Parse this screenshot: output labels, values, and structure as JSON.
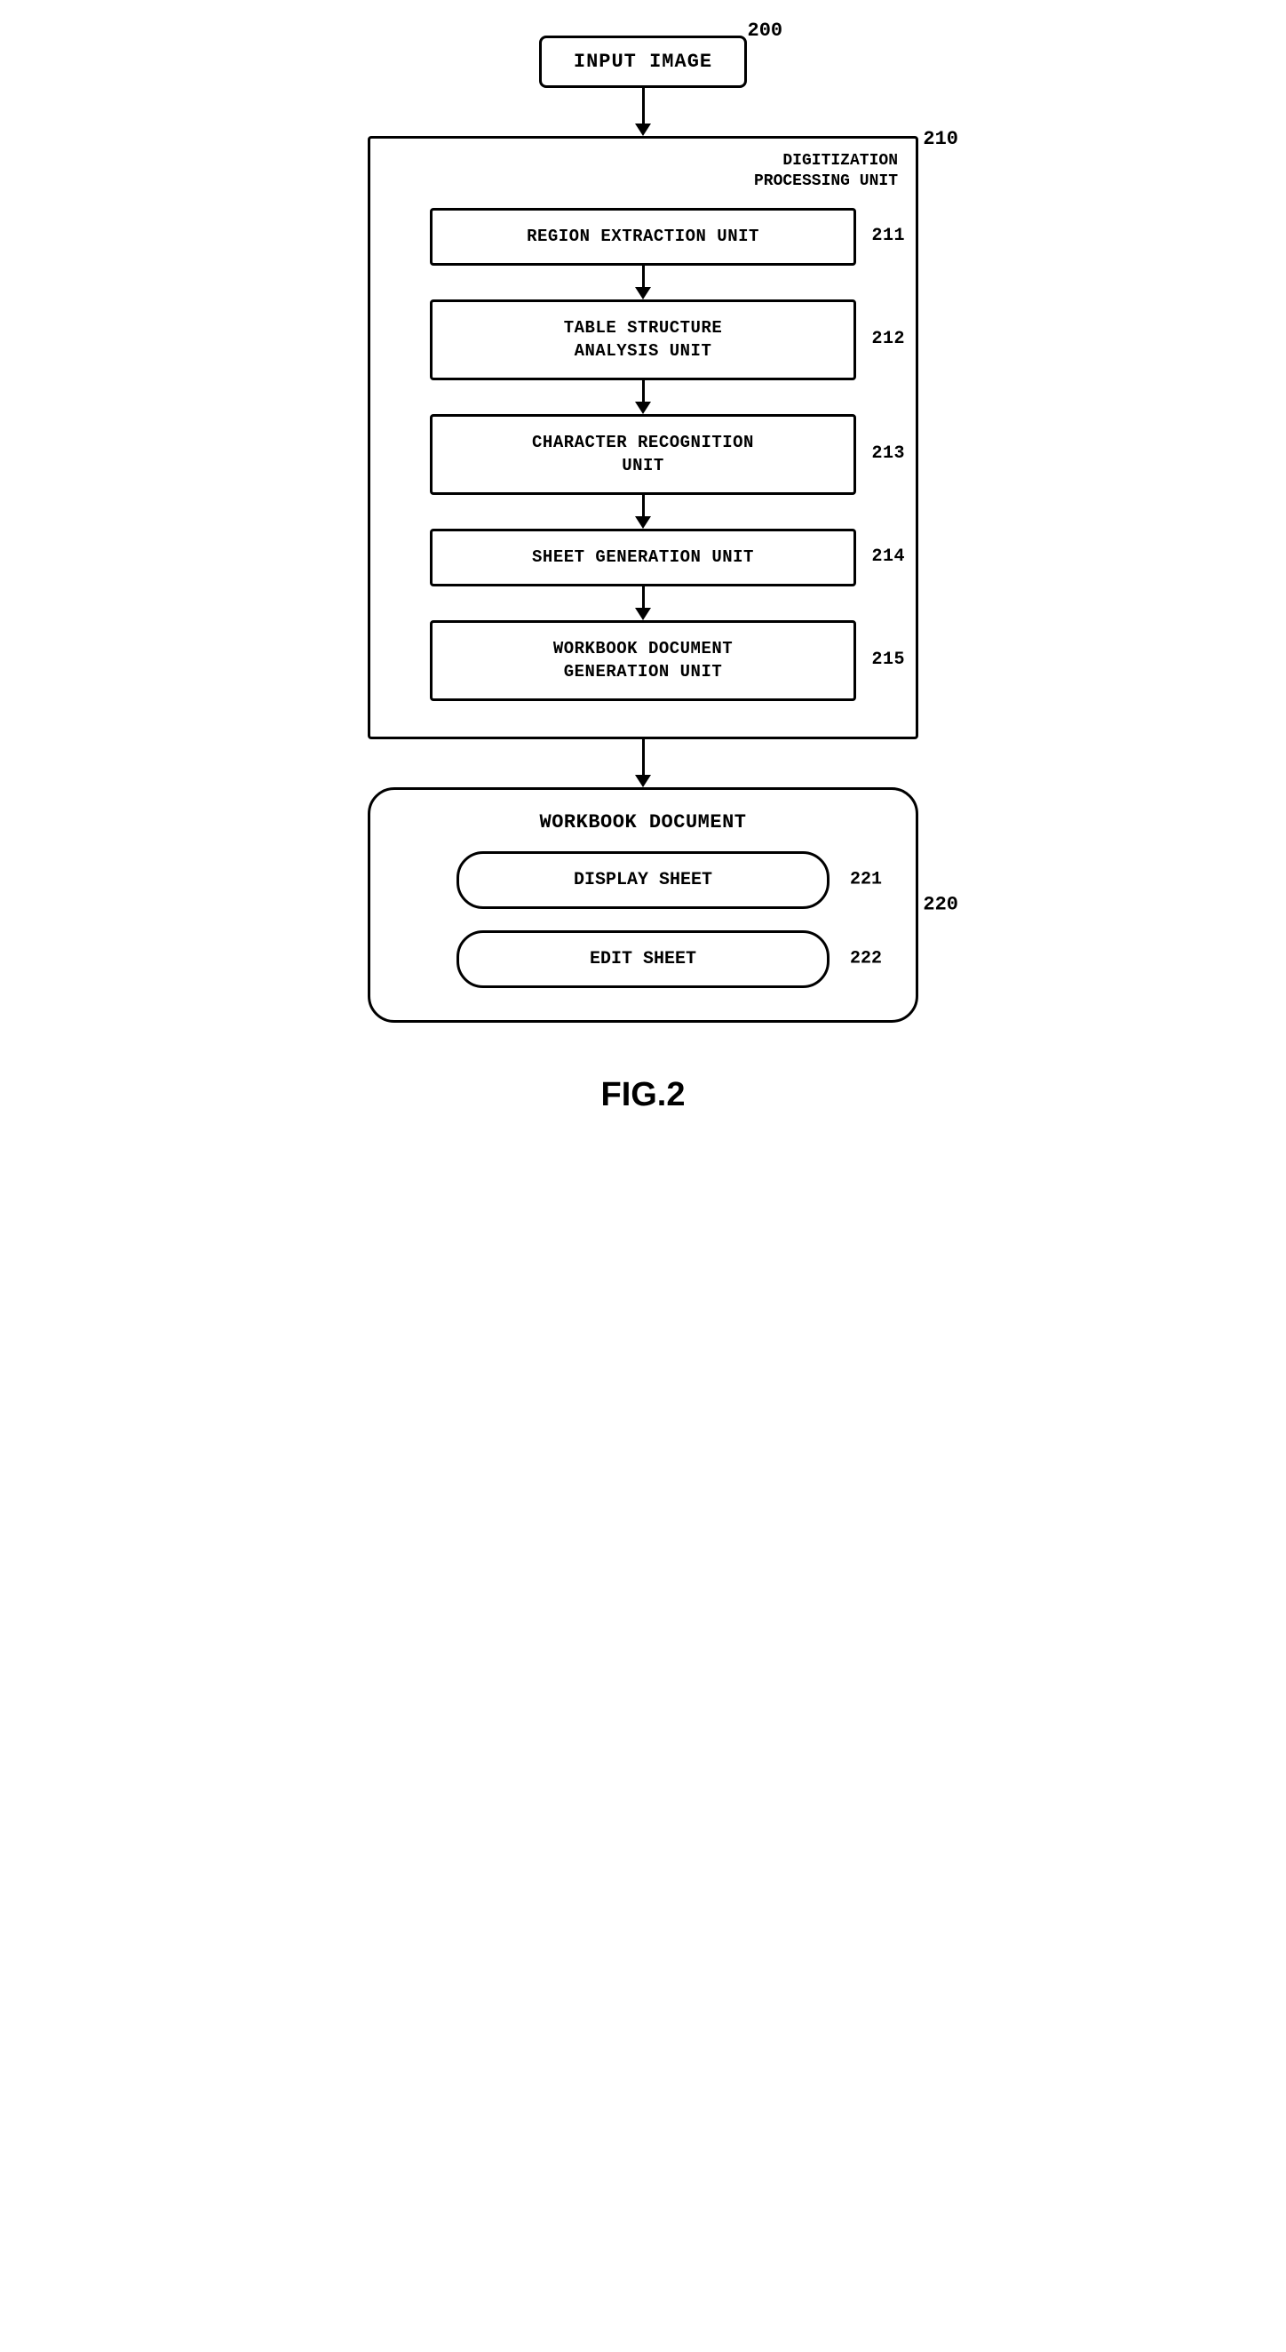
{
  "input_image": {
    "label": "INPUT IMAGE",
    "ref": "200"
  },
  "digitization_unit": {
    "label": "DIGITIZATION\nPROCESSING UNIT",
    "ref": "210",
    "units": [
      {
        "id": "211",
        "label": "REGION EXTRACTION UNIT",
        "ref": "211"
      },
      {
        "id": "212",
        "label": "TABLE STRUCTURE\nANALYSIS UNIT",
        "ref": "212"
      },
      {
        "id": "213",
        "label": "CHARACTER RECOGNITION\nUNIT",
        "ref": "213"
      },
      {
        "id": "214",
        "label": "SHEET GENERATION UNIT",
        "ref": "214"
      },
      {
        "id": "215",
        "label": "WORKBOOK DOCUMENT\nGENERATION UNIT",
        "ref": "215"
      }
    ]
  },
  "workbook_document": {
    "title": "WORKBOOK DOCUMENT",
    "ref": "220",
    "sheets": [
      {
        "id": "221",
        "label": "DISPLAY SHEET",
        "ref": "221"
      },
      {
        "id": "222",
        "label": "EDIT SHEET",
        "ref": "222"
      }
    ]
  },
  "figure_caption": "FIG.2",
  "arrow_heights": {
    "top_to_outer": 40,
    "between_units": 28,
    "outer_to_workbook": 40
  }
}
